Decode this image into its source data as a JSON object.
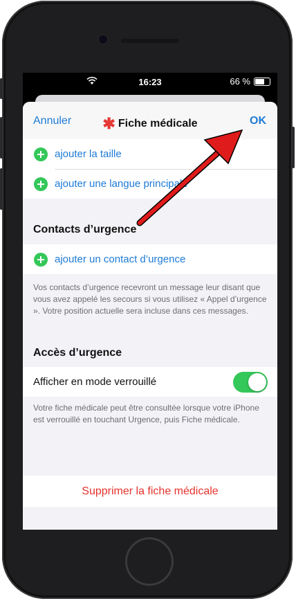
{
  "status_bar": {
    "time": "16:23",
    "battery": "66 %"
  },
  "nav": {
    "cancel_label": "Annuler",
    "title": "Fiche médicale",
    "ok_label": "OK"
  },
  "medical_rows": [
    {
      "label": "ajouter la taille"
    },
    {
      "label": "ajouter une langue principale"
    }
  ],
  "emergency_contacts": {
    "header": "Contacts d’urgence",
    "add_label": "ajouter un contact d’urgence",
    "footnote": "Vos contacts d’urgence recevront un message leur disant que vous avez appelé les secours si vous utilisez « Appel d’urgence ». Votre position actuelle sera incluse dans ces messages."
  },
  "emergency_access": {
    "header": "Accès d’urgence",
    "toggle_label": "Afficher en mode verrouillé",
    "toggle_on": true,
    "footnote": "Votre fiche médicale peut être consultée lorsque votre iPhone est verrouillé en touchant Urgence, puis Fiche médicale."
  },
  "delete_label": "Supprimer la fiche médicale",
  "colors": {
    "accent": "#1e7bd6",
    "add_green": "#34c759",
    "destructive": "#e5332b",
    "annotation_arrow": "#e01b1b"
  }
}
